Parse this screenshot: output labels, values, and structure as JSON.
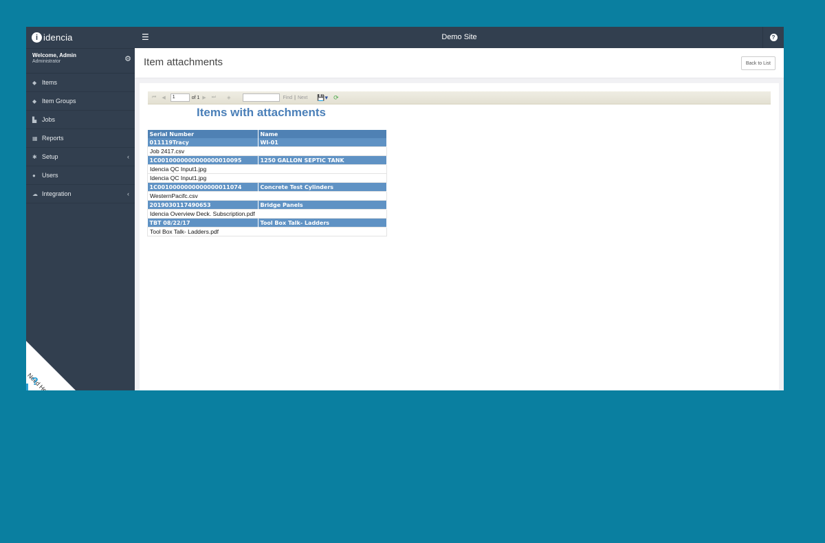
{
  "app": {
    "logo_text": "idencia",
    "site_title": "Demo Site"
  },
  "profile": {
    "welcome": "Welcome, Admin",
    "role": "Administrator"
  },
  "sidebar": {
    "items": [
      {
        "label": "Items",
        "icon": "tag-icon",
        "glyph": "◆"
      },
      {
        "label": "Item Groups",
        "icon": "tags-icon",
        "glyph": "◆"
      },
      {
        "label": "Jobs",
        "icon": "files-icon",
        "glyph": "▙"
      },
      {
        "label": "Reports",
        "icon": "chart-icon",
        "glyph": "▦"
      },
      {
        "label": "Setup",
        "icon": "cogs-icon",
        "glyph": "✱",
        "chevron": "‹"
      },
      {
        "label": "Users",
        "icon": "users-icon",
        "glyph": "●"
      },
      {
        "label": "Integration",
        "icon": "cloud-icon",
        "glyph": "☁",
        "chevron": "‹"
      }
    ],
    "help_label": "Need Help",
    "help_glyph": "?"
  },
  "page": {
    "title": "Item attachments",
    "back_button": "Back to List"
  },
  "report_toolbar": {
    "page_value": "1",
    "page_of": "of 1",
    "find_placeholder": "",
    "find_label": "Find",
    "separator": "|",
    "next_label": "Next"
  },
  "report": {
    "title": "Items with attachments",
    "columns": [
      "Serial Number",
      "Name"
    ],
    "groups": [
      {
        "serial": "011119Tracy",
        "name": "WI-01",
        "files": [
          "Job 2417.csv"
        ]
      },
      {
        "serial": "1C0010000000000000010095",
        "name": "1250 GALLON SEPTIC TANK",
        "files": [
          "Idencia QC Input1.jpg",
          "Idencia QC Input1.jpg"
        ]
      },
      {
        "serial": "1C0010000000000000011074",
        "name": "Concrete Test Cylinders",
        "files": [
          "WesternPacifc.csv"
        ]
      },
      {
        "serial": "2019030117490653",
        "name": "Bridge Panels",
        "files": [
          "Idencia Overview Deck. Subscription.pdf"
        ]
      },
      {
        "serial": "TBT 08/22/17",
        "name": "Tool Box Talk- Ladders",
        "files": [
          "Tool Box Talk- Ladders.pdf"
        ]
      }
    ]
  }
}
